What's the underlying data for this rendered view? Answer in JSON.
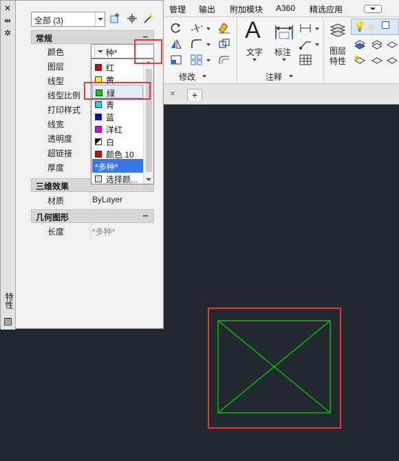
{
  "ribbon": {
    "tabs": [
      "管理",
      "输出",
      "附加模块",
      "A360",
      "精选应用"
    ],
    "panels": {
      "modify": "修改",
      "annotation": "注释"
    },
    "big_buttons": {
      "text": "文字",
      "dimension": "标注",
      "layer_properties": "图层\n特性"
    }
  },
  "document_tabs": {
    "close_glyph": "×",
    "add_glyph": "+"
  },
  "palette": {
    "strip": {
      "close_glyph": "✕",
      "pin_glyph": "⇹",
      "options_glyph": "✲",
      "title": "特性",
      "bottom_glyph": "回"
    },
    "object_selector": "全部 (3)",
    "sections": {
      "general": "常规",
      "3d_effects": "三维效果",
      "geometry": "几何图形"
    },
    "collapse_glyph": "−",
    "general_props": [
      {
        "name": "颜色",
        "value": "*多种*"
      },
      {
        "name": "图层",
        "value": ""
      },
      {
        "name": "线型",
        "value": ""
      },
      {
        "name": "线型比例",
        "value": ""
      },
      {
        "name": "打印样式",
        "value": ""
      },
      {
        "name": "线宽",
        "value": ""
      },
      {
        "name": "透明度",
        "value": ""
      },
      {
        "name": "超链接",
        "value": ""
      },
      {
        "name": "厚度",
        "value": ""
      }
    ],
    "effects_props": [
      {
        "name": "材质",
        "value": "ByLayer"
      }
    ],
    "geometry_props": [
      {
        "name": "长度",
        "value": "*多种*"
      }
    ],
    "color_dropdown": {
      "current": "*多种*",
      "options": [
        {
          "label": "红",
          "color": "#e00000"
        },
        {
          "label": "黄",
          "color": "#ffff00"
        },
        {
          "label": "绿",
          "color": "#00c800"
        },
        {
          "label": "青",
          "color": "#00e0e0"
        },
        {
          "label": "蓝",
          "color": "#0000e0"
        },
        {
          "label": "洋红",
          "color": "#e000e0"
        },
        {
          "label": "白",
          "color": "#ffffff"
        },
        {
          "label": "颜色 10",
          "color": "#e00000"
        },
        {
          "label": "*多种*",
          "color": ""
        },
        {
          "label": "选择颜...",
          "color": ""
        }
      ]
    }
  },
  "colors": {
    "drawing_background": "#212830",
    "geometry_stroke": "#00c800",
    "highlight_box": "#e53935",
    "selected_option": "#3b78e7"
  }
}
